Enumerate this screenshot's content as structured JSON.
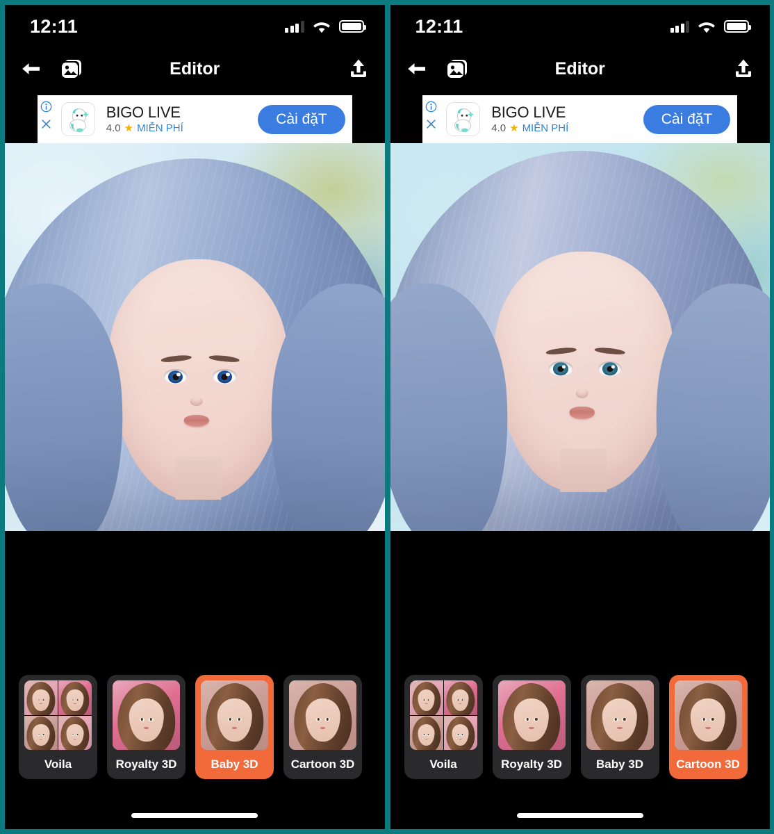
{
  "theme": {
    "border_color": "#0b7b80",
    "app_bg": "#000000",
    "accent_selected": "#f2693a",
    "ad_cta_color": "#3b7ce0",
    "card_bg": "#2a2a2c"
  },
  "panels": [
    {
      "id": "left",
      "status_bar": {
        "time": "12:11",
        "signal_icon": "cellular-signal-icon",
        "wifi_icon": "wifi-icon",
        "battery_icon": "battery-icon"
      },
      "nav": {
        "back_icon": "arrow-left-icon",
        "gallery_icon": "photo-stack-icon",
        "title": "Editor",
        "share_icon": "share-upload-icon"
      },
      "ad": {
        "info_icon": "info-icon",
        "close_icon": "close-icon",
        "app_icon": "bigo-live-app-icon",
        "title": "BIGO LIVE",
        "rating": "4.0",
        "star_icon": "star-icon",
        "price_label": "MIỄN PHÍ",
        "cta_label": "Cài đặT"
      },
      "preview": {
        "alt": "3d-cartoon-portrait-blue-hair",
        "applied_style": "Baby 3D"
      },
      "styles": [
        {
          "label": "Voila",
          "thumb": "voila-quad-thumb",
          "selected": false
        },
        {
          "label": "Royalty 3D",
          "thumb": "royalty-3d-thumb",
          "selected": false
        },
        {
          "label": "Baby 3D",
          "thumb": "baby-3d-thumb",
          "selected": true
        },
        {
          "label": "Cartoon 3D",
          "thumb": "cartoon-3d-thumb",
          "selected": false
        }
      ],
      "home_indicator": "home-indicator"
    },
    {
      "id": "right",
      "status_bar": {
        "time": "12:11",
        "signal_icon": "cellular-signal-icon",
        "wifi_icon": "wifi-icon",
        "battery_icon": "battery-icon"
      },
      "nav": {
        "back_icon": "arrow-left-icon",
        "gallery_icon": "photo-stack-icon",
        "title": "Editor",
        "share_icon": "share-upload-icon"
      },
      "ad": {
        "info_icon": "info-icon",
        "close_icon": "close-icon",
        "app_icon": "bigo-live-app-icon",
        "title": "BIGO LIVE",
        "rating": "4.0",
        "star_icon": "star-icon",
        "price_label": "MIỄN PHÍ",
        "cta_label": "Cài đặT"
      },
      "preview": {
        "alt": "3d-cartoon-portrait-blue-hair",
        "applied_style": "Cartoon 3D"
      },
      "styles": [
        {
          "label": "Voila",
          "thumb": "voila-quad-thumb",
          "selected": false
        },
        {
          "label": "Royalty 3D",
          "thumb": "royalty-3d-thumb",
          "selected": false
        },
        {
          "label": "Baby 3D",
          "thumb": "baby-3d-thumb",
          "selected": false
        },
        {
          "label": "Cartoon 3D",
          "thumb": "cartoon-3d-thumb",
          "selected": true
        }
      ],
      "home_indicator": "home-indicator"
    }
  ]
}
